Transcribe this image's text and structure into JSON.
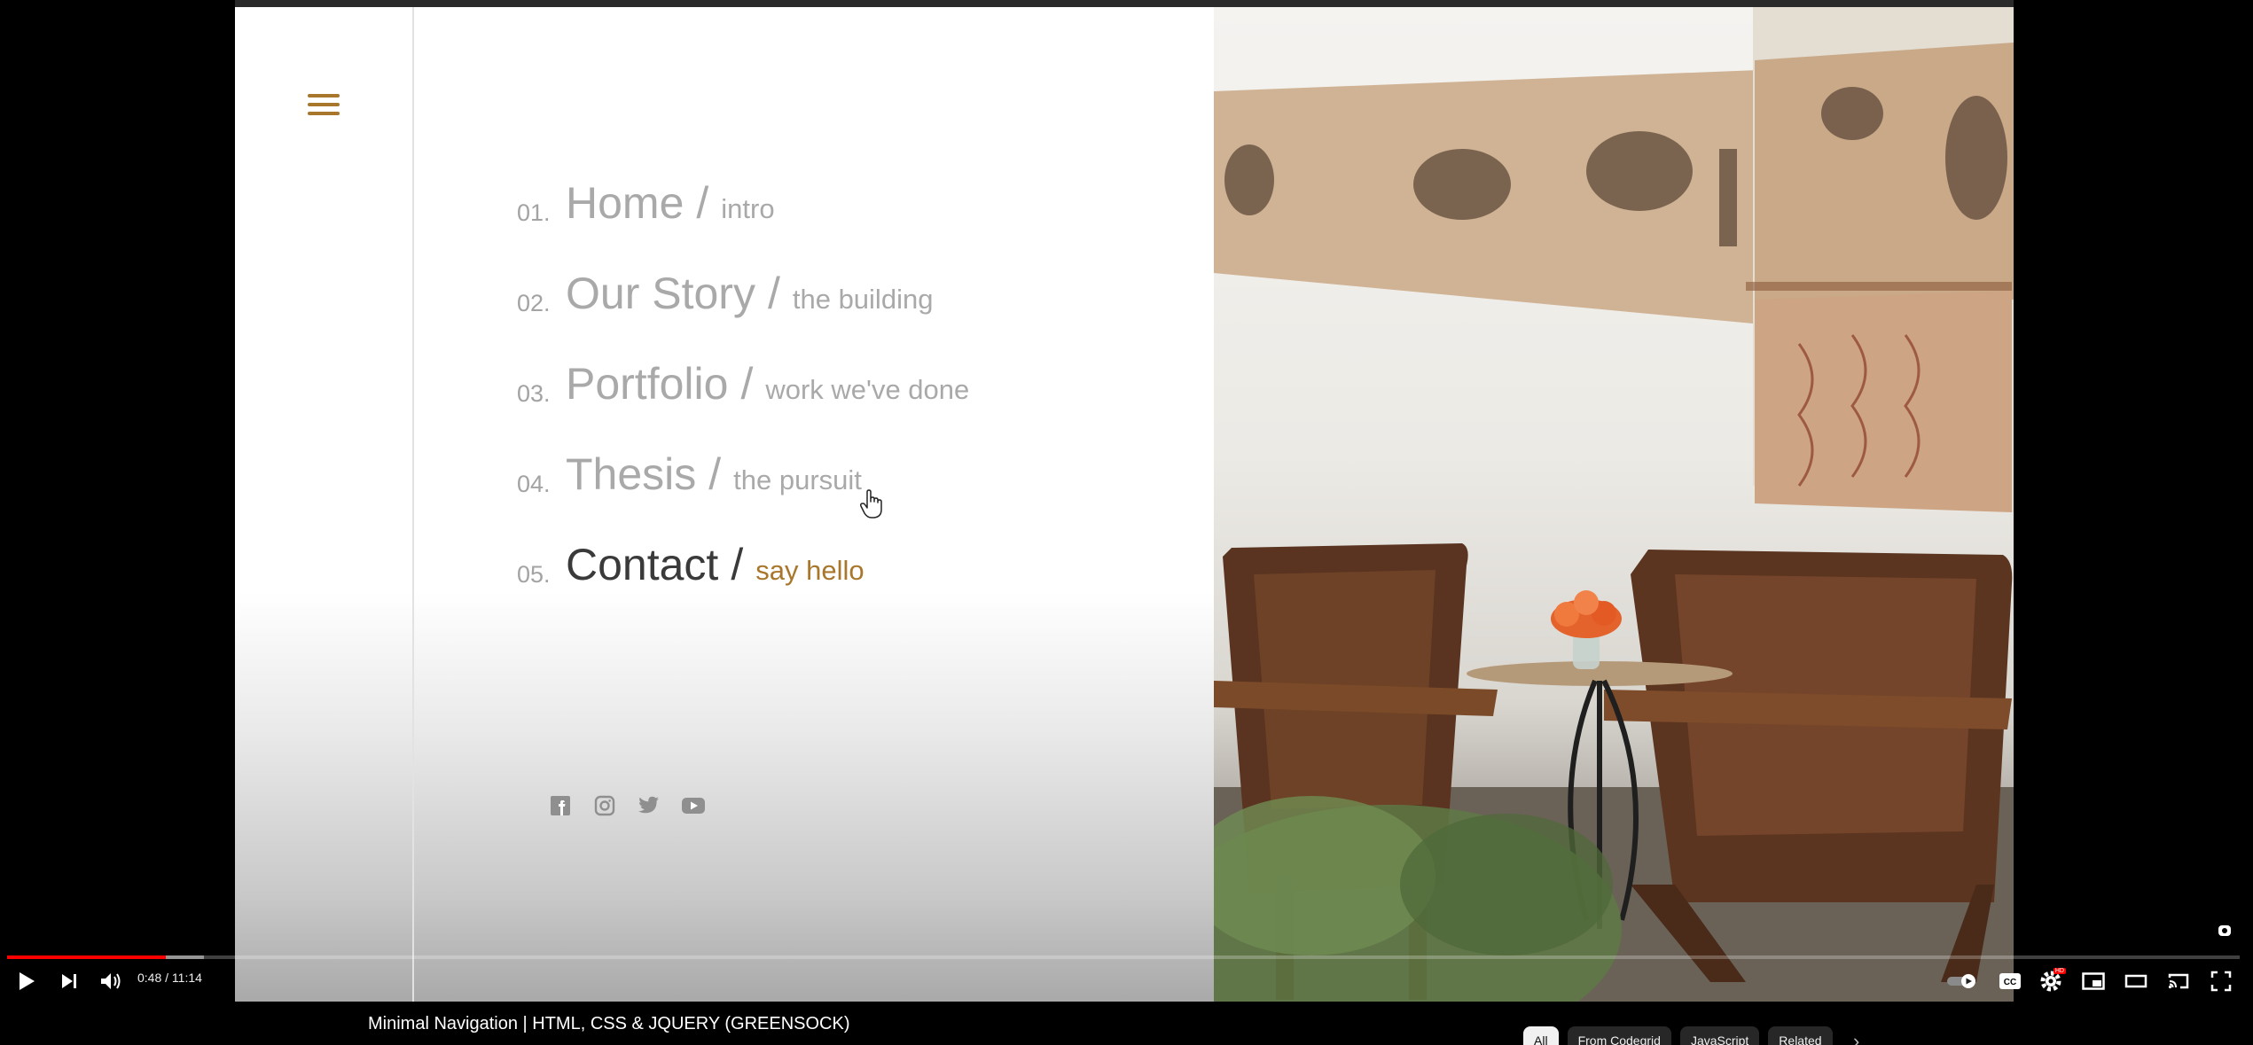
{
  "menu": {
    "items": [
      {
        "number": "01.",
        "title": "Home",
        "separator": "/",
        "subtitle": "intro"
      },
      {
        "number": "02.",
        "title": "Our Story",
        "separator": "/",
        "subtitle": "the building"
      },
      {
        "number": "03.",
        "title": "Portfolio",
        "separator": "/",
        "subtitle": "work we've done"
      },
      {
        "number": "04.",
        "title": "Thesis",
        "separator": "/",
        "subtitle": "the pursuit"
      },
      {
        "number": "05.",
        "title": "Contact",
        "separator": "/",
        "subtitle": "say hello"
      }
    ],
    "active_index": 4,
    "accent_color": "#a8772c"
  },
  "socials": [
    "facebook-icon",
    "instagram-icon",
    "twitter-icon",
    "youtube-icon"
  ],
  "player": {
    "time": "0:48 / 11:14",
    "progress_fraction": 0.071,
    "buffered_fraction": 0.088,
    "progress_color": "#ff0000",
    "controls": [
      "play-icon",
      "next-icon",
      "volume-icon",
      "autoplay-toggle",
      "captions-icon",
      "settings-icon",
      "miniplayer-icon",
      "theater-mode-icon",
      "cast-icon",
      "fullscreen-icon"
    ],
    "settings_badge": "HD"
  },
  "video": {
    "title": "Minimal Navigation | HTML, CSS & JQUERY (GREENSOCK)"
  },
  "chips": [
    {
      "label": "All",
      "selected": true
    },
    {
      "label": "From Codegrid",
      "selected": false
    },
    {
      "label": "JavaScript",
      "selected": false
    },
    {
      "label": "Related",
      "selected": false
    }
  ]
}
